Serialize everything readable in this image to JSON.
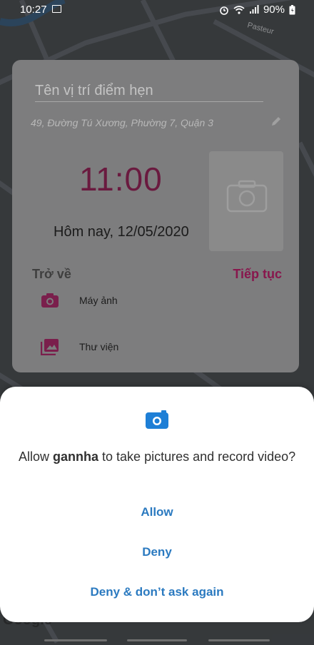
{
  "status_bar": {
    "time": "10:27",
    "battery": "90%"
  },
  "map": {
    "street_label": "Pasteur"
  },
  "card": {
    "name_placeholder": "Tên vị trí điểm hẹn",
    "address": "49, Đường Tú Xương, Phường 7, Quận 3",
    "time": "11:00",
    "date": "Hôm nay, 12/05/2020",
    "back_label": "Trở về",
    "next_label": "Tiếp tục",
    "options": [
      {
        "label": "Máy ảnh",
        "icon": "camera-icon"
      },
      {
        "label": "Thư viện",
        "icon": "gallery-icon"
      }
    ]
  },
  "dialog": {
    "message_prefix": "Allow ",
    "app_name": "gannha",
    "message_suffix": " to take pictures and record video?",
    "allow_label": "Allow",
    "deny_label": "Deny",
    "deny_never_label": "Deny & don’t ask again"
  },
  "map_attribution": "Google",
  "colors": {
    "accent": "#88174d",
    "dialog_button": "#2b7ac0"
  }
}
